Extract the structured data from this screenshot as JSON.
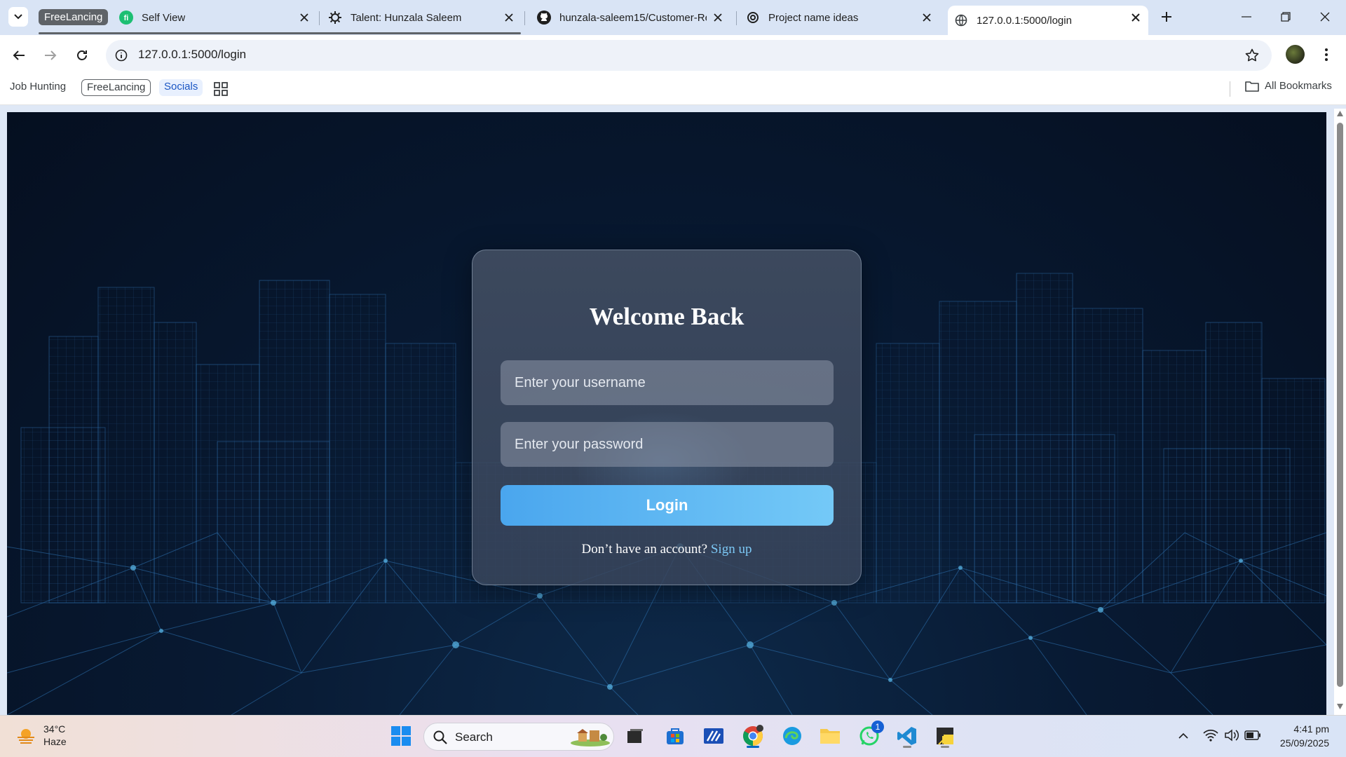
{
  "browser": {
    "tab_group_label": "FreeLancing",
    "tabs": [
      {
        "title": "Self View",
        "icon": "fiverr-icon"
      },
      {
        "title": "Talent: Hunzala Saleem",
        "icon": "gear-icon"
      },
      {
        "title": "hunzala-saleem15/Customer-Re",
        "icon": "github-icon"
      },
      {
        "title": "Project name ideas",
        "icon": "openai-icon"
      },
      {
        "title": "127.0.0.1:5000/login",
        "icon": "globe-icon",
        "active": true
      }
    ],
    "url": "127.0.0.1:5000/login",
    "bookmarks": [
      "Job Hunting",
      "FreeLancing",
      "Socials"
    ],
    "all_bookmarks_label": "All Bookmarks"
  },
  "login": {
    "heading": "Welcome Back",
    "username_placeholder": "Enter your username",
    "password_placeholder": "Enter your password",
    "login_button": "Login",
    "signup_prompt": "Don’t have an account?",
    "signup_link": "Sign up"
  },
  "taskbar": {
    "weather_temp": "34°C",
    "weather_desc": "Haze",
    "search_label": "Search",
    "whatsapp_badge": "1",
    "time": "4:41 pm",
    "date": "25/09/2025"
  },
  "colors": {
    "accent": "#4aa6ee",
    "page_bg": "#081a33",
    "link": "#7cc8f5"
  }
}
